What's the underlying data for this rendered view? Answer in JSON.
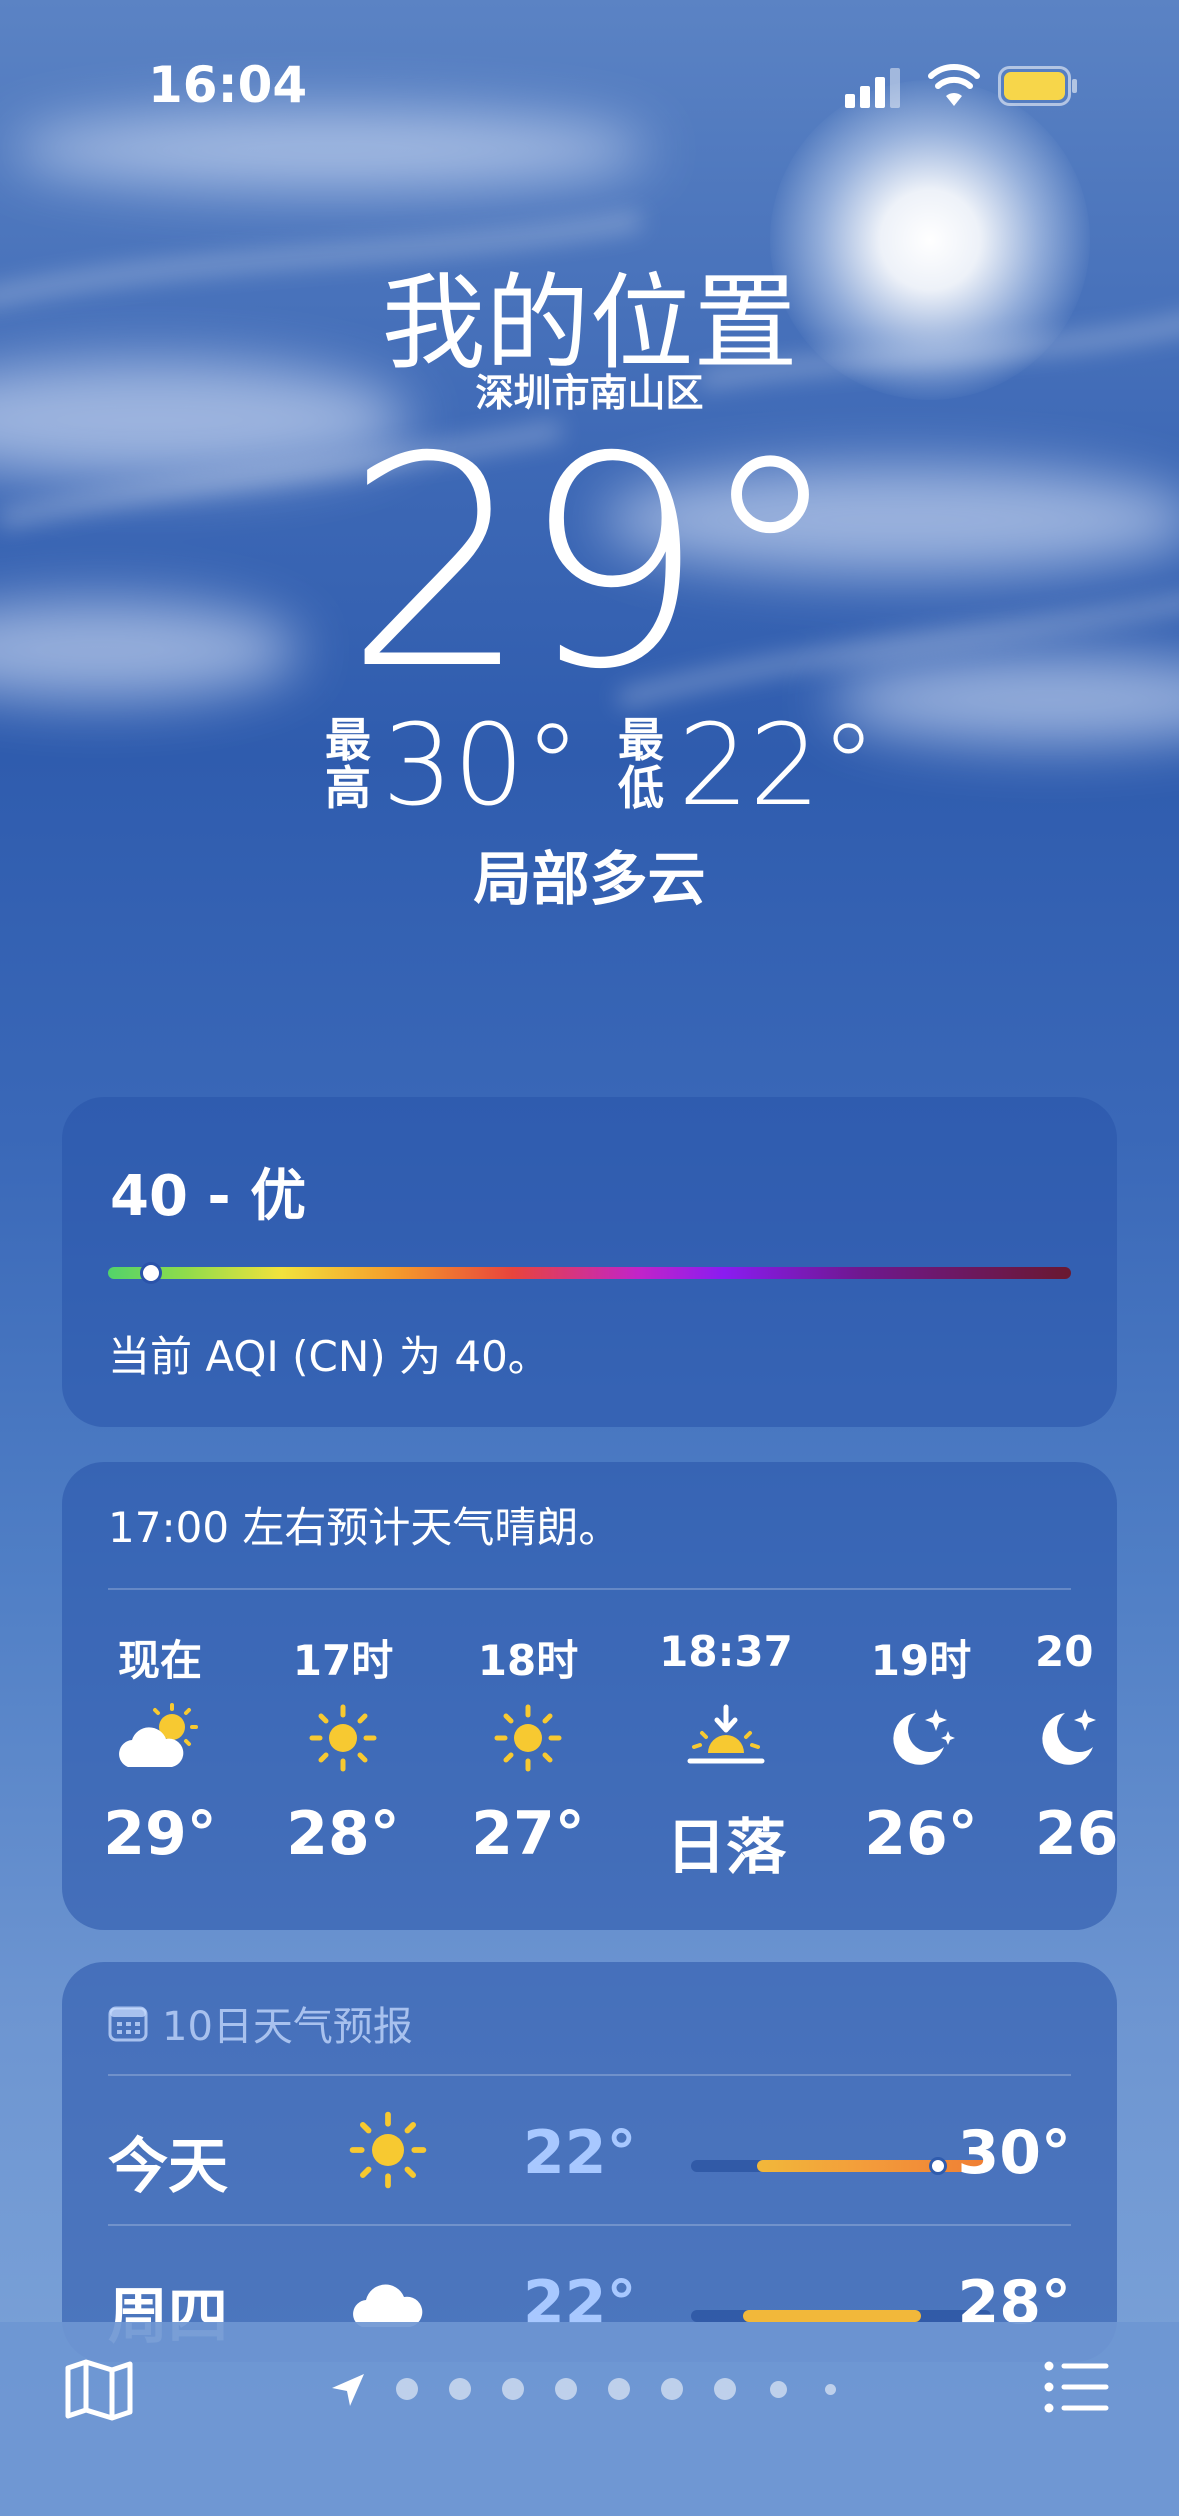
{
  "status": {
    "time": "16:04"
  },
  "header": {
    "location": "我的位置",
    "sublocation": "深圳市南山区",
    "temperature": "29°",
    "high_label_1": "最",
    "high_label_2": "高",
    "high_value": "30°",
    "low_label_1": "最",
    "low_label_2": "低",
    "low_value": "22°",
    "condition": "局部多云"
  },
  "aqi": {
    "title": "40 - 优",
    "value": 40,
    "description": "当前 AQI (CN) 为 40。"
  },
  "hourly": {
    "summary": "17:00 左右预计天气晴朗。",
    "items": [
      {
        "label": "现在",
        "icon": "partly-cloudy-sun-icon",
        "temp": "29°"
      },
      {
        "label": "17时",
        "icon": "sun-icon",
        "temp": "28°"
      },
      {
        "label": "18时",
        "icon": "sun-icon",
        "temp": "27°"
      },
      {
        "label": "18:37",
        "icon": "sunset-icon",
        "temp": "日落"
      },
      {
        "label": "19时",
        "icon": "moon-stars-icon",
        "temp": "26°"
      },
      {
        "label": "20",
        "icon": "moon-icon",
        "temp": "26"
      }
    ]
  },
  "daily": {
    "header": "10日天气预报",
    "days": [
      {
        "name": "今天",
        "icon": "sun-icon",
        "low": "22°",
        "high": "30°",
        "current_marker": true
      },
      {
        "name": "周四",
        "icon": "cloud-icon",
        "low": "22°",
        "high": "28°",
        "current_marker": false
      }
    ]
  },
  "colors": {
    "sun": "#f7c931",
    "range_today": "#f3a13a",
    "range_thursday": "#f2b83a",
    "battery": "#f7d64a"
  }
}
